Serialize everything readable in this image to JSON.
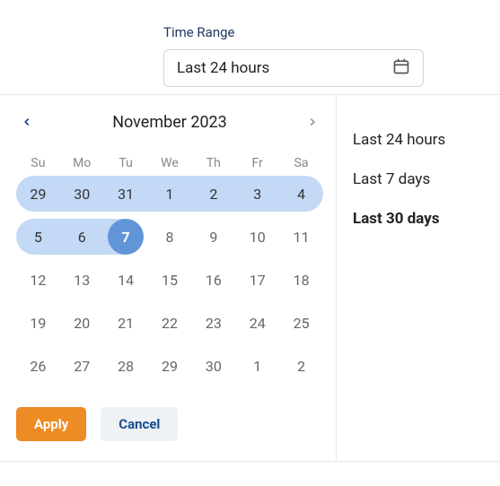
{
  "header": {
    "label": "Time Range"
  },
  "input": {
    "value": "Last 24 hours"
  },
  "calendar": {
    "month_title": "November 2023",
    "weekdays": [
      "Su",
      "Mo",
      "Tu",
      "We",
      "Th",
      "Fr",
      "Sa"
    ],
    "days": [
      {
        "n": "29",
        "cls": "in-range range-start"
      },
      {
        "n": "30",
        "cls": "in-range"
      },
      {
        "n": "31",
        "cls": "in-range"
      },
      {
        "n": "1",
        "cls": "in-range"
      },
      {
        "n": "2",
        "cls": "in-range"
      },
      {
        "n": "3",
        "cls": "in-range"
      },
      {
        "n": "4",
        "cls": "in-range range-end-row"
      },
      {
        "n": "5",
        "cls": "in-range range-second-row-start"
      },
      {
        "n": "6",
        "cls": "in-range"
      },
      {
        "n": "7",
        "cls": "range-end selected"
      },
      {
        "n": "8",
        "cls": ""
      },
      {
        "n": "9",
        "cls": ""
      },
      {
        "n": "10",
        "cls": ""
      },
      {
        "n": "11",
        "cls": ""
      },
      {
        "n": "12",
        "cls": ""
      },
      {
        "n": "13",
        "cls": ""
      },
      {
        "n": "14",
        "cls": ""
      },
      {
        "n": "15",
        "cls": ""
      },
      {
        "n": "16",
        "cls": ""
      },
      {
        "n": "17",
        "cls": ""
      },
      {
        "n": "18",
        "cls": ""
      },
      {
        "n": "19",
        "cls": ""
      },
      {
        "n": "20",
        "cls": ""
      },
      {
        "n": "21",
        "cls": ""
      },
      {
        "n": "22",
        "cls": ""
      },
      {
        "n": "23",
        "cls": ""
      },
      {
        "n": "24",
        "cls": ""
      },
      {
        "n": "25",
        "cls": ""
      },
      {
        "n": "26",
        "cls": ""
      },
      {
        "n": "27",
        "cls": ""
      },
      {
        "n": "28",
        "cls": ""
      },
      {
        "n": "29",
        "cls": ""
      },
      {
        "n": "30",
        "cls": ""
      },
      {
        "n": "1",
        "cls": ""
      },
      {
        "n": "2",
        "cls": ""
      }
    ]
  },
  "actions": {
    "apply": "Apply",
    "cancel": "Cancel"
  },
  "presets": [
    {
      "label": "Last 24 hours",
      "active": false
    },
    {
      "label": "Last 7 days",
      "active": false
    },
    {
      "label": "Last 30 days",
      "active": true
    }
  ]
}
